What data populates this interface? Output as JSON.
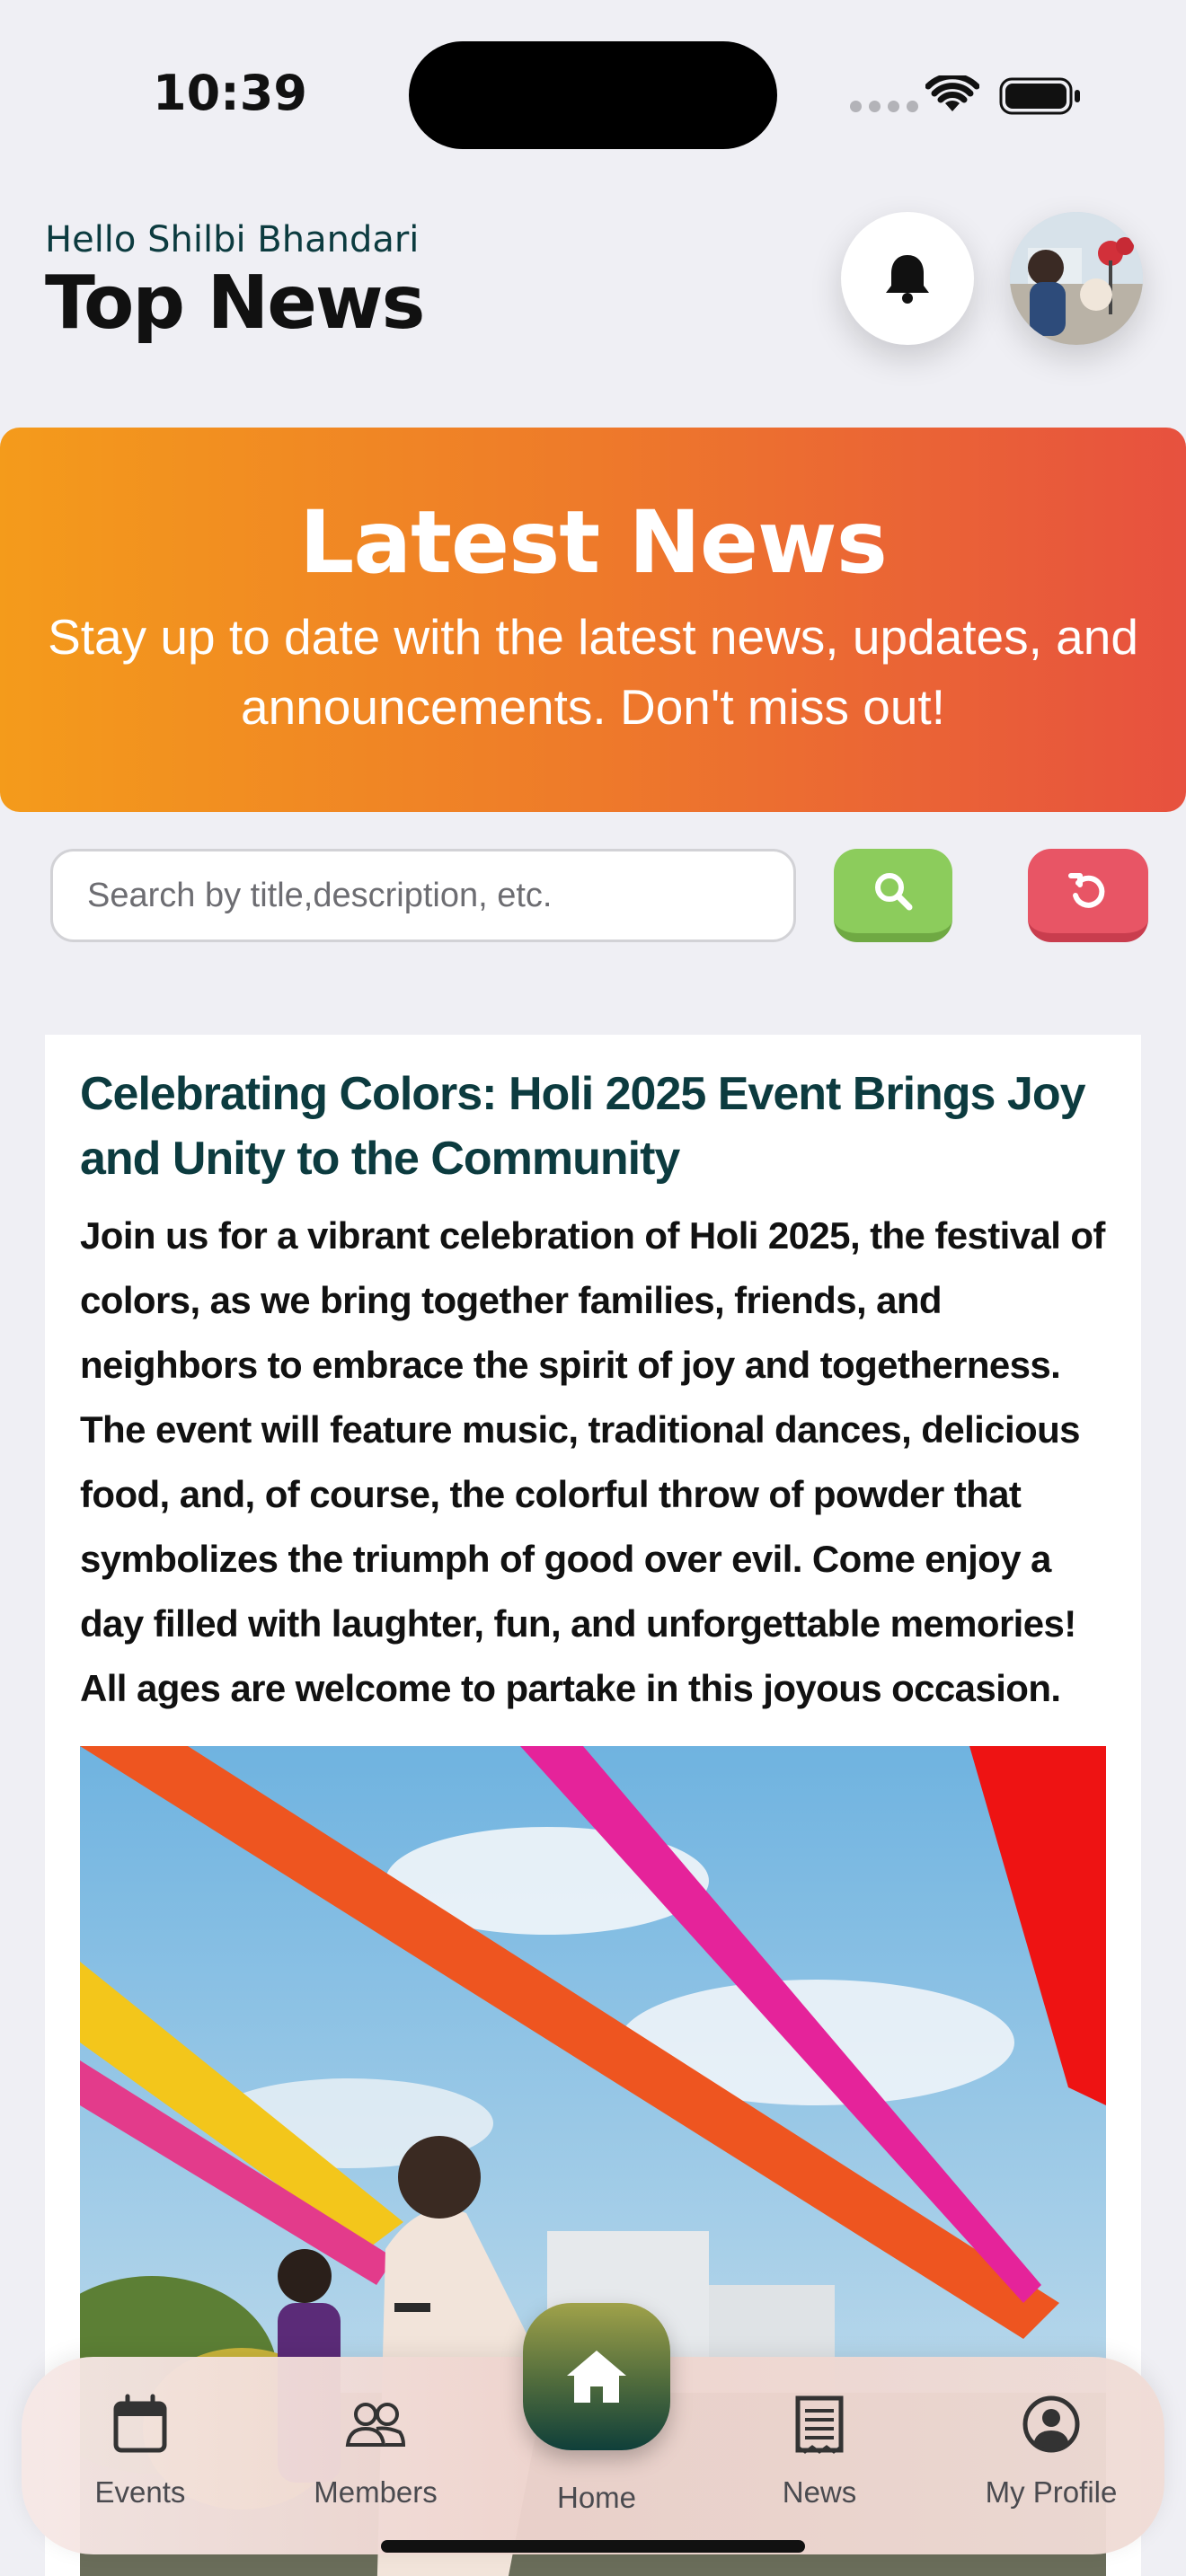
{
  "status_bar": {
    "time": "10:39"
  },
  "header": {
    "greeting": "Hello Shilbi Bhandari",
    "title": "Top News",
    "bell_icon": "bell-icon",
    "avatar": "user-avatar"
  },
  "banner": {
    "title": "Latest News",
    "subtitle": "Stay up to date with the latest news, updates, and announcements. Don't miss out!",
    "colors": [
      "#f49b1b",
      "#e7513f"
    ]
  },
  "search": {
    "placeholder": "Search by title,description, etc.",
    "value": "",
    "search_icon": "search-icon",
    "reset_icon": "reset-icon",
    "search_color": "#8ccc5c",
    "reset_color": "#e85565"
  },
  "news": [
    {
      "title": "Celebrating Colors: Holi 2025 Event Brings Joy and Unity to the Community",
      "description": "Join us for a vibrant celebration of Holi 2025, the festival of colors, as we bring together families, friends, and neighbors to embrace the spirit of joy and togetherness. The event will feature music, traditional dances, delicious food, and, of course, the colorful throw of powder that symbolizes the triumph of good over evil. Come enjoy a day filled with laughter, fun, and unforgettable memories! All ages are welcome to partake in this joyous occasion.",
      "image": "holi-celebration-photo"
    }
  ],
  "bottom_nav": {
    "items": [
      {
        "label": "Events",
        "icon": "calendar-icon"
      },
      {
        "label": "Members",
        "icon": "members-icon"
      },
      {
        "label": "Home",
        "icon": "home-icon"
      },
      {
        "label": "News",
        "icon": "newspaper-icon"
      },
      {
        "label": "My Profile",
        "icon": "profile-icon"
      }
    ],
    "active": "Home"
  }
}
